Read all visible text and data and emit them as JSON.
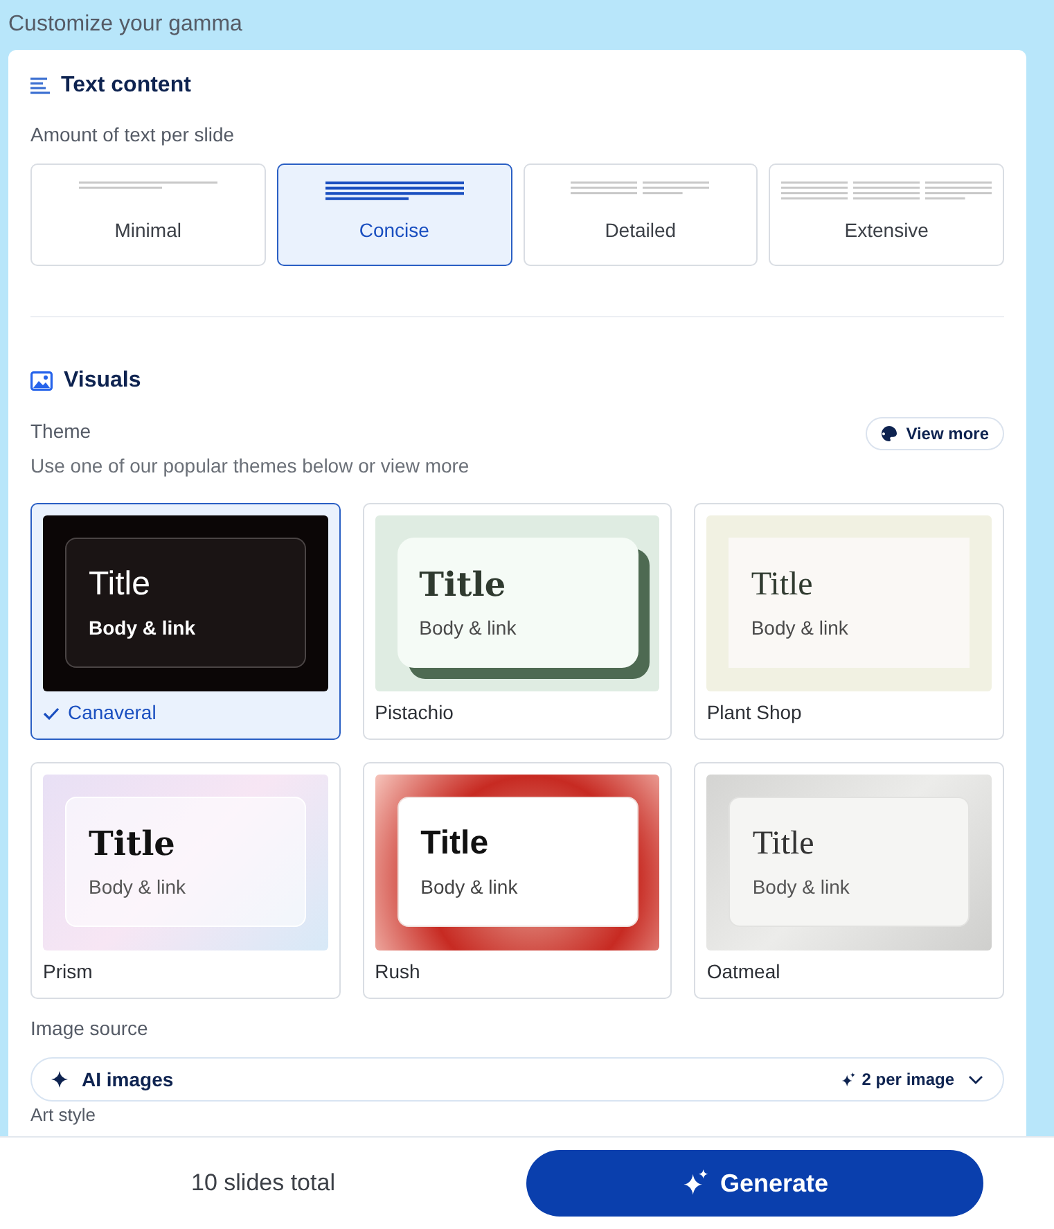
{
  "heading": "Customize your gamma",
  "text_content": {
    "title": "Text content",
    "label": "Amount of text per slide",
    "options": [
      {
        "label": "Minimal",
        "kind": "minimal",
        "selected": false
      },
      {
        "label": "Concise",
        "kind": "concise",
        "selected": true
      },
      {
        "label": "Detailed",
        "kind": "detailed",
        "selected": false
      },
      {
        "label": "Extensive",
        "kind": "extensive",
        "selected": false
      }
    ]
  },
  "visuals": {
    "title": "Visuals",
    "theme_label": "Theme",
    "theme_hint": "Use one of our popular themes below or view more",
    "view_more": "View more",
    "themes": [
      {
        "name": "Canaveral",
        "kind": "canaveral",
        "selected": true,
        "title": "Title",
        "body": "Body & link"
      },
      {
        "name": "Pistachio",
        "kind": "pistachio",
        "selected": false,
        "title": "Title",
        "body": "Body & link"
      },
      {
        "name": "Plant Shop",
        "kind": "plantshop",
        "selected": false,
        "title": "Title",
        "body": "Body & link"
      },
      {
        "name": "Prism",
        "kind": "prism",
        "selected": false,
        "title": "Title",
        "body": "Body & link"
      },
      {
        "name": "Rush",
        "kind": "rush",
        "selected": false,
        "title": "Title",
        "body": "Body & link"
      },
      {
        "name": "Oatmeal",
        "kind": "oatmeal",
        "selected": false,
        "title": "Title",
        "body": "Body & link"
      }
    ],
    "image_source_label": "Image source",
    "image_source": "AI images",
    "per_image": "2 per image",
    "art_style_label": "Art style"
  },
  "footer": {
    "total": "10 slides total",
    "generate": "Generate"
  }
}
